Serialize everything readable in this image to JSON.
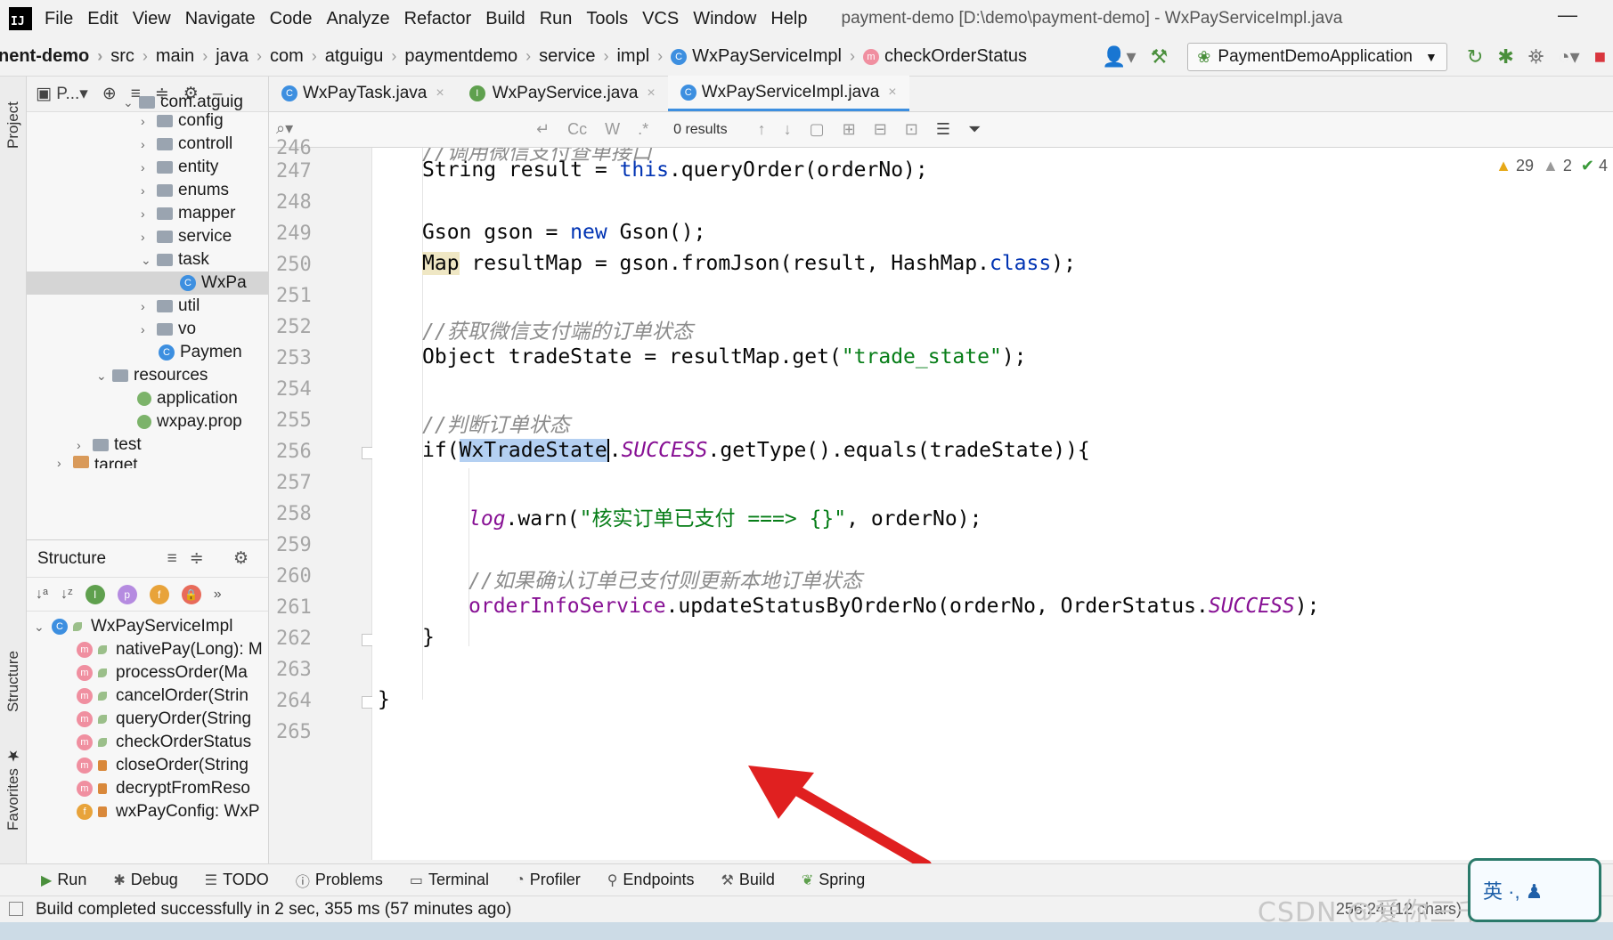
{
  "menubar": {
    "items": [
      "File",
      "Edit",
      "View",
      "Navigate",
      "Code",
      "Analyze",
      "Refactor",
      "Build",
      "Run",
      "Tools",
      "VCS",
      "Window",
      "Help"
    ],
    "title": "payment-demo [D:\\demo\\payment-demo] - WxPayServiceImpl.java"
  },
  "breadcrumb": [
    "nent-demo",
    "src",
    "main",
    "java",
    "com",
    "atguigu",
    "paymentdemo",
    "service",
    "impl",
    "WxPayServiceImpl",
    "checkOrderStatus"
  ],
  "run_config": "PaymentDemoApplication",
  "project_panel": {
    "label": "P...",
    "tree": [
      {
        "label": "com.atguig",
        "indent": 0
      },
      {
        "label": "config",
        "indent": 1
      },
      {
        "label": "controll",
        "indent": 1
      },
      {
        "label": "entity",
        "indent": 1
      },
      {
        "label": "enums",
        "indent": 1
      },
      {
        "label": "mapper",
        "indent": 1
      },
      {
        "label": "service",
        "indent": 1
      },
      {
        "label": "task",
        "indent": 1
      },
      {
        "label": "WxPa",
        "indent": 2
      },
      {
        "label": "util",
        "indent": 1
      },
      {
        "label": "vo",
        "indent": 1
      },
      {
        "label": "Paymen",
        "indent": 2
      },
      {
        "label": "resources",
        "indent": 0
      },
      {
        "label": "application",
        "indent": 1
      },
      {
        "label": "wxpay.prop",
        "indent": 1
      },
      {
        "label": "test",
        "indent": 0
      },
      {
        "label": "target",
        "indent": 0
      }
    ]
  },
  "structure_panel": {
    "title": "Structure",
    "class_name": "WxPayServiceImpl",
    "members": [
      "nativePay(Long): M",
      "processOrder(Ma",
      "cancelOrder(Strin",
      "queryOrder(String",
      "checkOrderStatus",
      "closeOrder(String",
      "decryptFromReso",
      "wxPayConfig: WxP"
    ]
  },
  "editor_tabs": [
    {
      "label": "WxPayTask.java",
      "badge": "C"
    },
    {
      "label": "WxPayService.java",
      "badge": "I"
    },
    {
      "label": "WxPayServiceImpl.java",
      "badge": "C",
      "active": true
    }
  ],
  "search": {
    "placeholder": "",
    "results": "0 results",
    "tools": [
      "Cc",
      "W",
      ".*"
    ]
  },
  "inspections": {
    "warnings": "29",
    "weak_warnings": "2",
    "ok": "4"
  },
  "line_numbers": [
    "246",
    "247",
    "248",
    "249",
    "250",
    "251",
    "252",
    "253",
    "254",
    "255",
    "256",
    "257",
    "258",
    "259",
    "260",
    "261",
    "262",
    "263",
    "264",
    "265"
  ],
  "code": {
    "l246": "//调用微信支付查单接口",
    "l247_a": "String result = ",
    "l247_b": "this",
    "l247_c": ".queryOrder(orderNo);",
    "l249_a": "Gson gson = ",
    "l249_b": "new",
    "l249_c": " Gson();",
    "l250_a": "Map",
    "l250_b": " resultMap = gson.fromJson(result, HashMap.",
    "l250_c": "class",
    "l250_d": ");",
    "l252": "//获取微信支付端的订单状态",
    "l253_a": "Object tradeState = resultMap.get(",
    "l253_b": "\"trade_state\"",
    "l253_c": ");",
    "l255": "//判断订单状态",
    "l256_a": "if(",
    "l256_b": "WxTradeState",
    "l256_c": ".",
    "l256_d": "SUCCESS",
    "l256_e": ".getType().equals(tradeState)){",
    "l258_a": "log",
    "l258_b": ".warn(",
    "l258_c": "\"核实订单已支付 ===> {}\"",
    "l258_d": ", orderNo);",
    "l260": "//如果确认订单已支付则更新本地订单状态",
    "l261_a": "orderInfoService",
    "l261_b": ".updateStatusByOrderNo(orderNo, OrderStatus.",
    "l261_c": "SUCCESS",
    "l261_d": ");",
    "l262": "}",
    "l264": "}"
  },
  "bottom_tools": [
    "Run",
    "Debug",
    "TODO",
    "Problems",
    "Terminal",
    "Profiler",
    "Endpoints",
    "Build",
    "Spring"
  ],
  "status": {
    "message": "Build completed successfully in 2 sec, 355 ms (57 minutes ago)",
    "position": "256:24 (12 chars)",
    "watermark": "CSDN @爱你三千遍斯塔克"
  },
  "ime": "英 ·, ♟",
  "colors": {
    "accent": "#3d8fe0",
    "arrow": "#e02020",
    "selection": "#b4d0f2"
  }
}
